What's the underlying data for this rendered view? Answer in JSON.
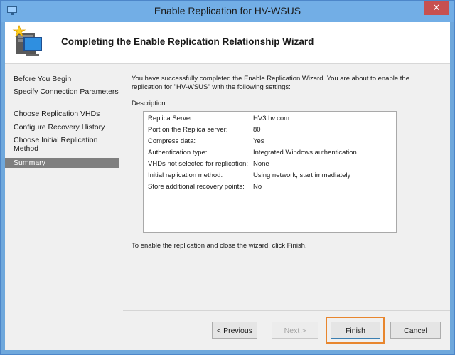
{
  "window": {
    "title": "Enable Replication for HV-WSUS",
    "close_glyph": "✕",
    "app_icon": "hyper-v-icon"
  },
  "header": {
    "title": "Completing the Enable Replication Relationship Wizard",
    "icon": "wizard-computer-icon"
  },
  "nav": {
    "items": [
      {
        "label": "Before You Begin",
        "selected": false
      },
      {
        "label": "Specify Connection Parameters",
        "selected": false
      },
      {
        "label": "Choose Replication VHDs",
        "selected": false
      },
      {
        "label": "Configure Recovery History",
        "selected": false
      },
      {
        "label": "Choose Initial Replication Method",
        "selected": false
      },
      {
        "label": "Summary",
        "selected": true
      }
    ]
  },
  "content": {
    "intro": "You have successfully completed the Enable Replication Wizard. You are about to enable the replication for \"HV-WSUS\" with the following settings:",
    "description_label": "Description:",
    "settings": [
      {
        "key": "Replica Server:",
        "value": "HV3.hv.com"
      },
      {
        "key": "Port on the Replica server:",
        "value": "80"
      },
      {
        "key": "Compress data:",
        "value": "Yes"
      },
      {
        "key": "Authentication type:",
        "value": "Integrated Windows authentication"
      },
      {
        "key": "VHDs not selected for replication:",
        "value": "None"
      },
      {
        "key": "Initial replication method:",
        "value": "Using network, start immediately"
      },
      {
        "key": "Store additional recovery points:",
        "value": "No"
      }
    ],
    "finish_note": "To enable the replication and close the wizard, click Finish."
  },
  "buttons": {
    "previous": "< Previous",
    "next": "Next >",
    "finish": "Finish",
    "cancel": "Cancel"
  },
  "colors": {
    "title_bar": "#72aee6",
    "close_button": "#c75050",
    "selected_nav": "#7f7f7f",
    "finish_highlight": "#e8862e"
  }
}
